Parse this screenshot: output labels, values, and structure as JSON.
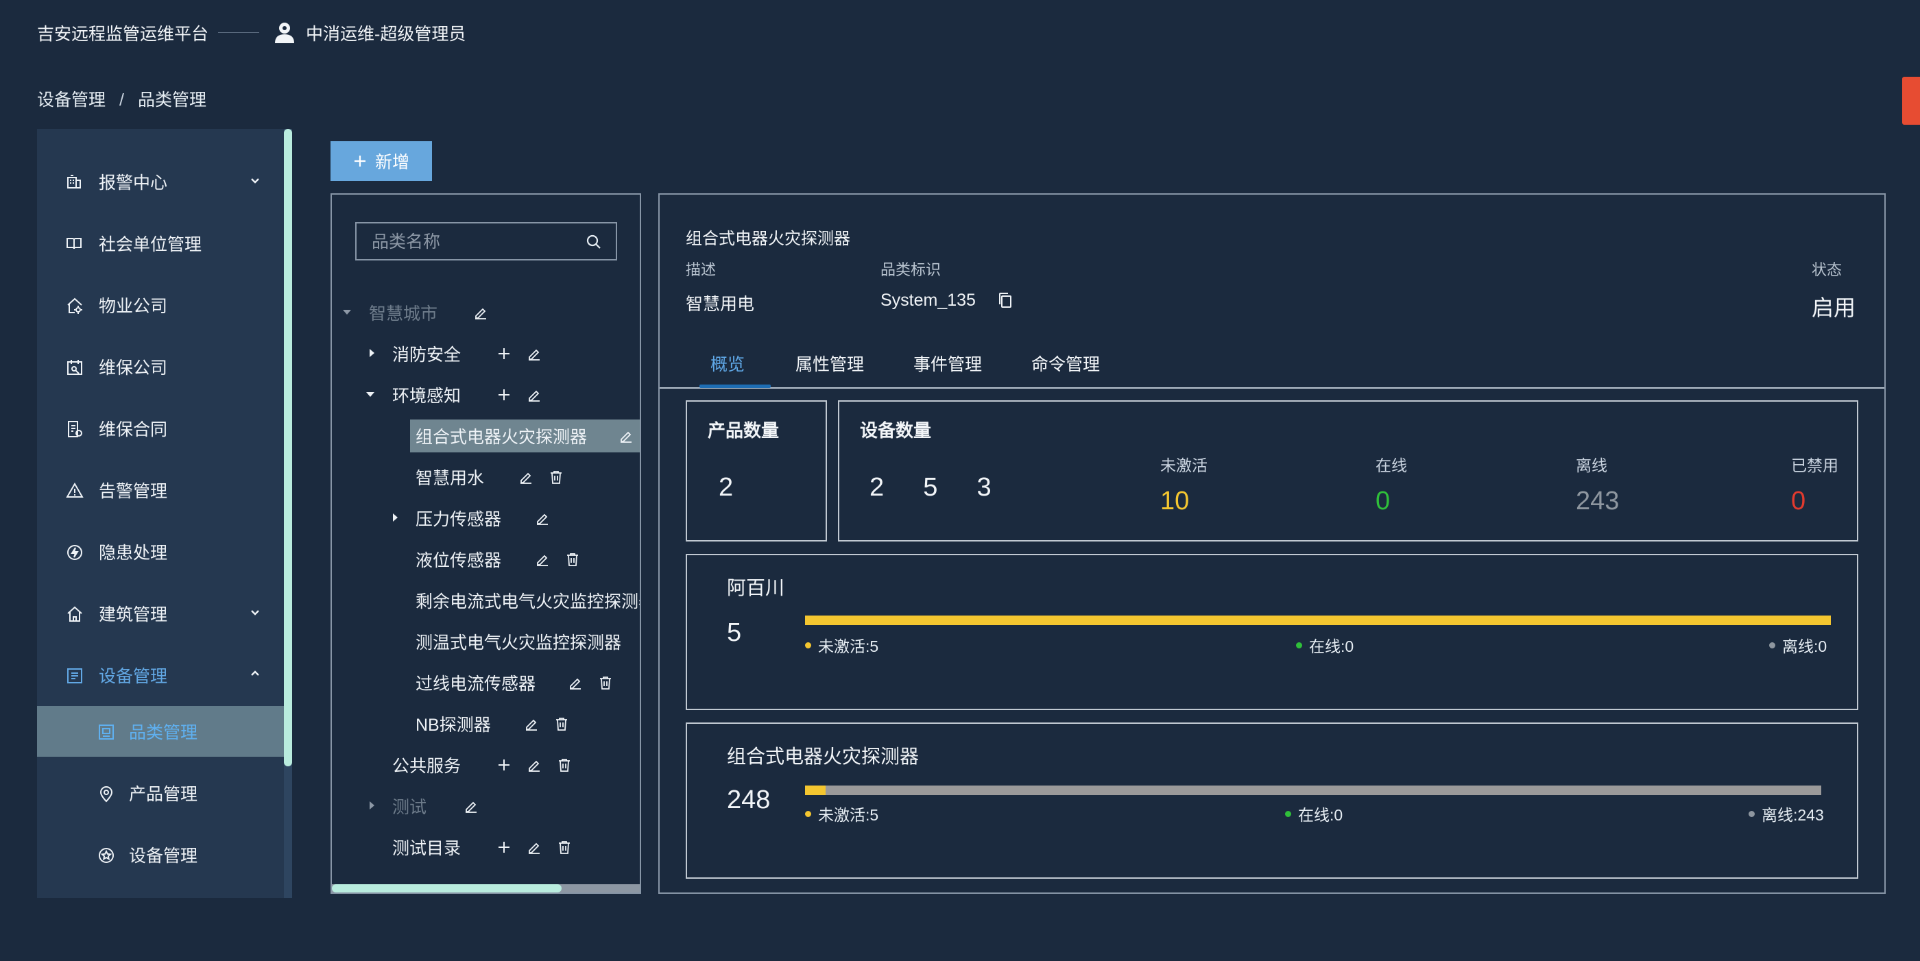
{
  "header": {
    "platform_title": "吉安远程监管运维平台",
    "user_label": "中消运维-超级管理员"
  },
  "breadcrumb": [
    "设备管理",
    "品类管理"
  ],
  "sidebar": {
    "items": [
      {
        "label": "报警中心",
        "icon": "alarm-building-icon",
        "expandable": true
      },
      {
        "label": "社会单位管理",
        "icon": "book-icon"
      },
      {
        "label": "物业公司",
        "icon": "house-gear-icon"
      },
      {
        "label": "维保公司",
        "icon": "maintenance-icon"
      },
      {
        "label": "维保合同",
        "icon": "contract-icon"
      },
      {
        "label": "告警管理",
        "icon": "warning-icon"
      },
      {
        "label": "隐患处理",
        "icon": "bolt-circle-icon"
      },
      {
        "label": "建筑管理",
        "icon": "home-icon",
        "expandable": true
      },
      {
        "label": "设备管理",
        "icon": "device-list-icon",
        "expanded": true
      }
    ],
    "sub_items": [
      {
        "label": "品类管理",
        "icon": "category-icon",
        "selected": true
      },
      {
        "label": "产品管理",
        "icon": "location-pin-icon"
      },
      {
        "label": "设备管理",
        "icon": "star-badge-icon"
      }
    ]
  },
  "toolbar": {
    "add_label": "新增"
  },
  "tree": {
    "search_placeholder": "品类名称",
    "nodes": [
      {
        "label": "智慧城市"
      },
      {
        "label": "消防安全"
      },
      {
        "label": "环境感知"
      },
      {
        "label": "组合式电器火灾探测器"
      },
      {
        "label": "智慧用水"
      },
      {
        "label": "压力传感器"
      },
      {
        "label": "液位传感器"
      },
      {
        "label": "剩余电流式电气火灾监控探测器"
      },
      {
        "label": "测温式电气火灾监控探测器"
      },
      {
        "label": "过线电流传感器"
      },
      {
        "label": "NB探测器"
      },
      {
        "label": "公共服务"
      },
      {
        "label": "测试"
      },
      {
        "label": "测试目录"
      }
    ]
  },
  "detail": {
    "title": "组合式电器火灾探测器",
    "desc_label": "描述",
    "desc_value": "智慧用电",
    "id_label": "品类标识",
    "id_value": "System_135",
    "status_label": "状态",
    "status_value": "启用",
    "tabs": [
      "概览",
      "属性管理",
      "事件管理",
      "命令管理"
    ],
    "product_count_label": "产品数量",
    "product_count": "2",
    "device_count_label": "设备数量",
    "device_count": "2  5  3",
    "stats": [
      {
        "label": "未激活",
        "value": "10",
        "color": "#f4c630"
      },
      {
        "label": "在线",
        "value": "0",
        "color": "#2fbf3a"
      },
      {
        "label": "离线",
        "value": "243",
        "color": "#8e969f"
      },
      {
        "label": "已禁用",
        "value": "0",
        "color": "#e03a2e"
      }
    ],
    "products": [
      {
        "name": "阿百川",
        "total": "5",
        "inactive_fraction": 1.0,
        "legend": [
          "未激活:5",
          "在线:0",
          "离线:0"
        ]
      },
      {
        "name": "组合式电器火灾探测器",
        "total": "248",
        "inactive_fraction": 0.02,
        "legend": [
          "未激活:5",
          "在线:0",
          "离线:243"
        ]
      }
    ]
  },
  "colors": {
    "background": "#1b2a3e",
    "accent": "#5fa7e6",
    "inactive": "#f4c630",
    "online": "#2fbf3a",
    "offline": "#8e969f",
    "disabled": "#e03a2e"
  }
}
